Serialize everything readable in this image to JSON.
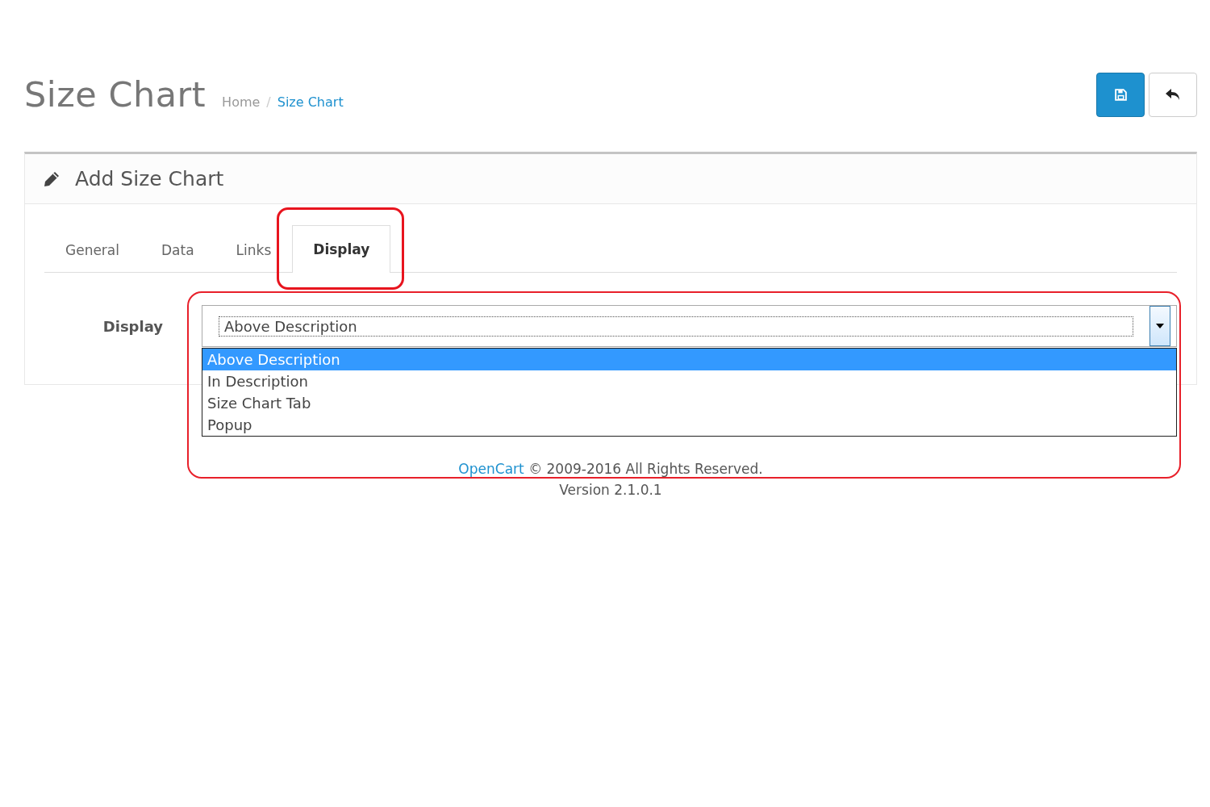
{
  "page": {
    "title": "Size Chart",
    "breadcrumb_separator": "/",
    "breadcrumb": [
      {
        "label": "Home",
        "current": false
      },
      {
        "label": "Size Chart",
        "current": true
      }
    ],
    "buttons": [
      {
        "kind": "save"
      },
      {
        "kind": "back"
      }
    ]
  },
  "panel": {
    "title": "Add Size Chart",
    "tabs": [
      {
        "label": "General",
        "selected": false,
        "highlighted": false
      },
      {
        "label": "Data",
        "selected": false,
        "highlighted": false
      },
      {
        "label": "Links",
        "selected": false,
        "highlighted": false
      },
      {
        "label": "Display",
        "selected": true,
        "highlighted": true
      }
    ],
    "field": {
      "label": "Display",
      "value": "Above Description",
      "expanded": true,
      "highlighted": true,
      "options": [
        {
          "label": "Above Description",
          "selected": true
        },
        {
          "label": "In Description",
          "selected": false
        },
        {
          "label": "Size Chart Tab",
          "selected": false
        },
        {
          "label": "Popup",
          "selected": false
        }
      ]
    }
  },
  "footer": {
    "link": "OpenCart",
    "text": "© 2009-2016 All Rights Reserved.",
    "version": "Version 2.1.0.1"
  }
}
